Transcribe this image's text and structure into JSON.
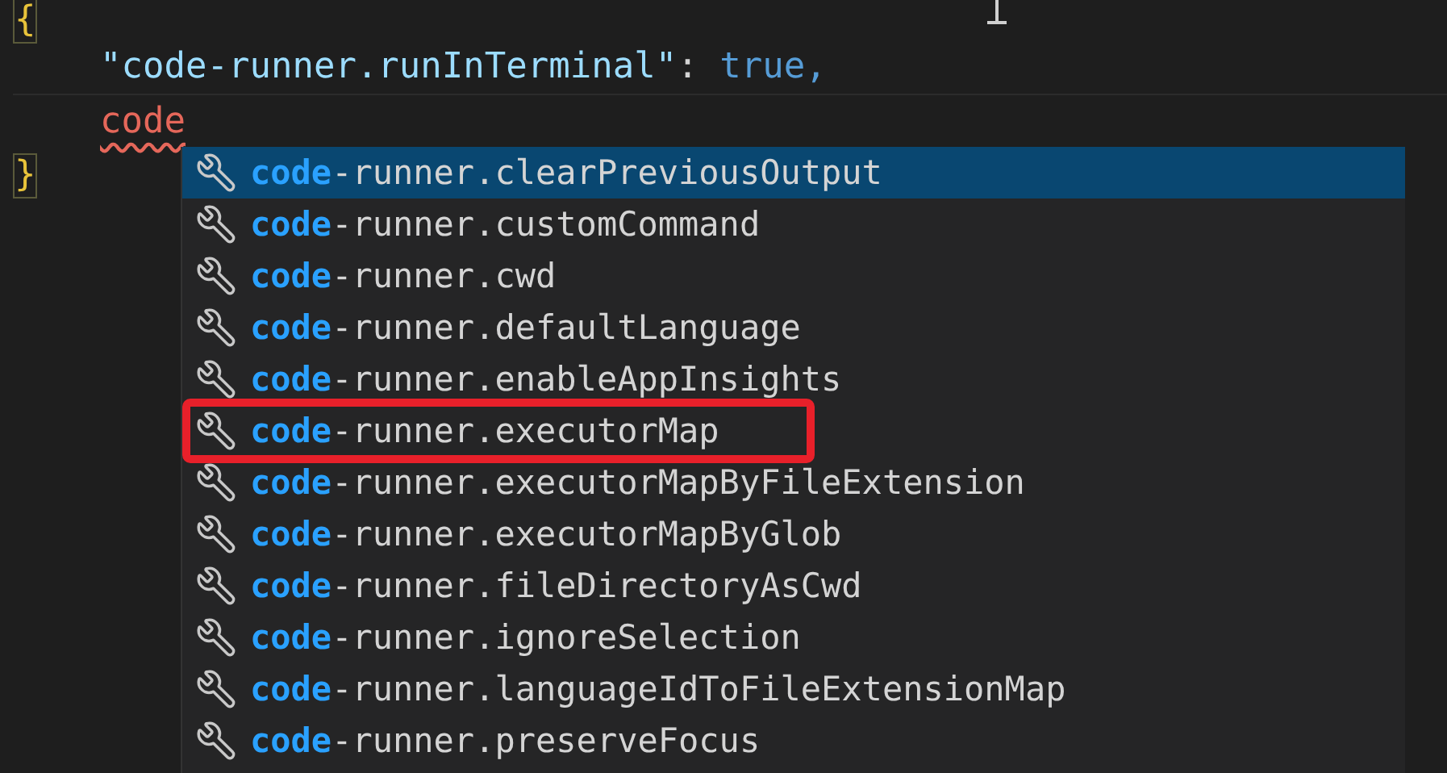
{
  "editor": {
    "lines": [
      {
        "kind": "brace",
        "text": "{"
      },
      {
        "kind": "property",
        "key": "\"code-runner.runInTerminal\"",
        "separator": ":",
        "value": "true,"
      },
      {
        "kind": "typing",
        "text": "code",
        "error": true
      },
      {
        "kind": "brace",
        "text": "}"
      }
    ]
  },
  "suggestions": [
    {
      "match": "code",
      "rest": "-runner.clearPreviousOutput",
      "selected": true,
      "highlighted": false
    },
    {
      "match": "code",
      "rest": "-runner.customCommand",
      "selected": false,
      "highlighted": false
    },
    {
      "match": "code",
      "rest": "-runner.cwd",
      "selected": false,
      "highlighted": false
    },
    {
      "match": "code",
      "rest": "-runner.defaultLanguage",
      "selected": false,
      "highlighted": false
    },
    {
      "match": "code",
      "rest": "-runner.enableAppInsights",
      "selected": false,
      "highlighted": false
    },
    {
      "match": "code",
      "rest": "-runner.executorMap",
      "selected": false,
      "highlighted": true
    },
    {
      "match": "code",
      "rest": "-runner.executorMapByFileExtension",
      "selected": false,
      "highlighted": false
    },
    {
      "match": "code",
      "rest": "-runner.executorMapByGlob",
      "selected": false,
      "highlighted": false
    },
    {
      "match": "code",
      "rest": "-runner.fileDirectoryAsCwd",
      "selected": false,
      "highlighted": false
    },
    {
      "match": "code",
      "rest": "-runner.ignoreSelection",
      "selected": false,
      "highlighted": false
    },
    {
      "match": "code",
      "rest": "-runner.languageIdToFileExtensionMap",
      "selected": false,
      "highlighted": false
    },
    {
      "match": "code",
      "rest": "-runner.preserveFocus",
      "selected": false,
      "highlighted": false
    }
  ]
}
